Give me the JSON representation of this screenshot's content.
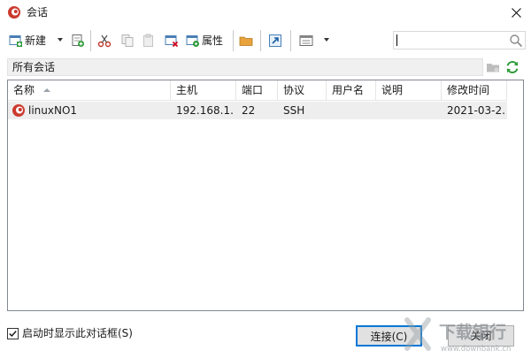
{
  "window": {
    "title": "会话"
  },
  "toolbar": {
    "new_label": "新建",
    "properties_label": "属性"
  },
  "search": {
    "value": "",
    "placeholder": ""
  },
  "folder": {
    "path": "所有会话"
  },
  "columns": [
    "名称",
    "主机",
    "端口",
    "协议",
    "用户名",
    "说明",
    "修改时间"
  ],
  "sessions": [
    {
      "name": "linuxNO1",
      "host": "192.168.1...",
      "port": "22",
      "protocol": "SSH",
      "user": "",
      "description": "",
      "modified": "2021-03-2..."
    }
  ],
  "footer": {
    "startup_label": "启动时显示此对话框(S)",
    "startup_checked": true,
    "connect_label": "连接(C)",
    "close_label": "关闭"
  },
  "watermark": {
    "text": "下载银行",
    "subtext": "www.downbank.cn"
  },
  "colors": {
    "accent": "#0078d7",
    "brand_red": "#cc3a2e",
    "refresh_green": "#2e9b3a"
  }
}
